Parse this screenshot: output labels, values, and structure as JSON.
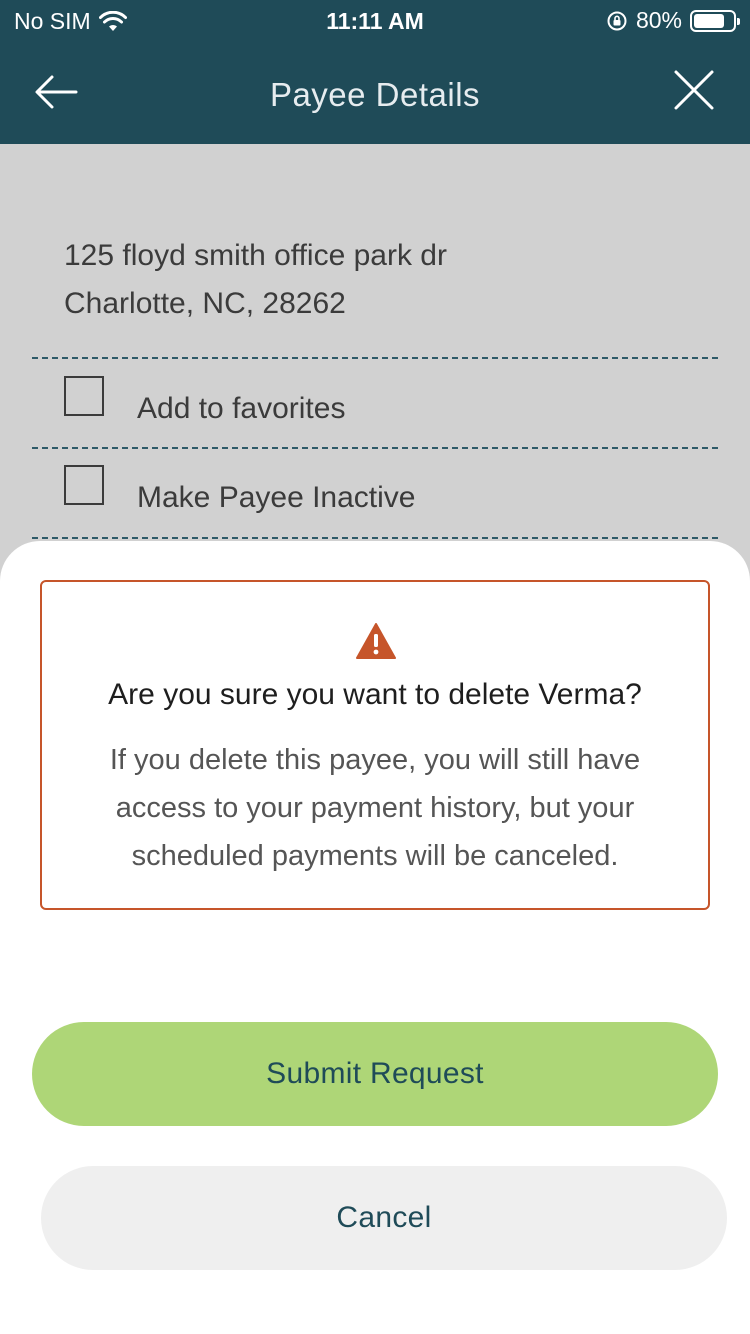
{
  "status_bar": {
    "carrier": "No SIM",
    "time": "11:11 AM",
    "battery_percent": "80%",
    "battery_level": 0.8,
    "icons": [
      "wifi-icon",
      "orientation-lock-icon",
      "battery-icon"
    ]
  },
  "nav": {
    "title": "Payee Details",
    "back_icon": "arrow-left-icon",
    "close_icon": "close-icon"
  },
  "payee": {
    "address_line1": "125 floyd smith office park dr",
    "address_line2": "Charlotte, NC, 28262"
  },
  "options": {
    "favorites_label": "Add to favorites",
    "favorites_checked": false,
    "inactive_label": "Make Payee Inactive",
    "inactive_checked": false
  },
  "dialog": {
    "icon": "warning-icon",
    "title": "Are you sure you want to delete Verma?",
    "body": "If you delete this payee, you will still have access to your payment history, but your scheduled payments will be canceled.",
    "submit_label": "Submit Request",
    "cancel_label": "Cancel"
  },
  "colors": {
    "header": "#1f4b58",
    "overlay_gray": "#d1d1d1",
    "warning": "#c6552a",
    "submit": "#aed677",
    "cancel": "#efefef"
  }
}
